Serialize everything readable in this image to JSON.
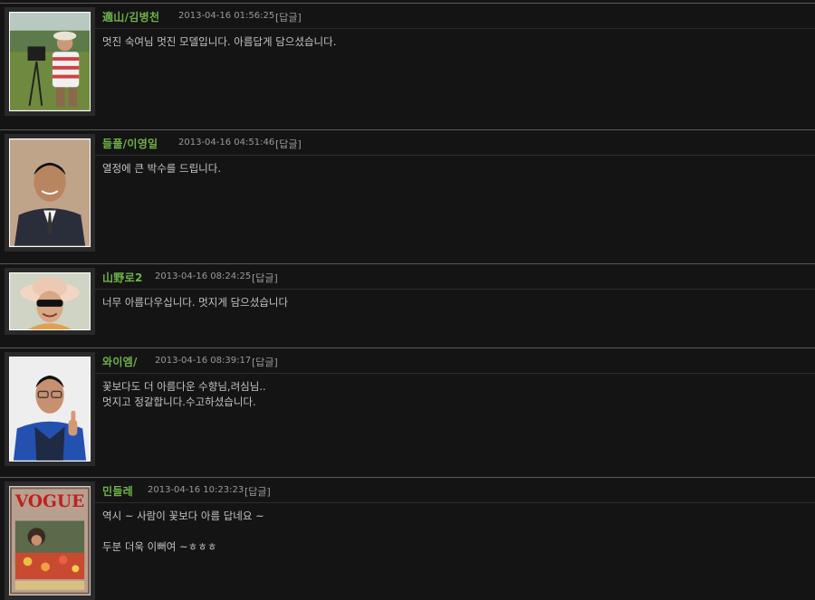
{
  "comments": [
    {
      "author": "適山/김병천",
      "date": "2013-04-16 01:56:25",
      "reply": "[답글]",
      "text": "멋진 숙여님 멋진 모델입니다. 아름답게 담으셨습니다."
    },
    {
      "author": "들풀/이영일",
      "date": "2013-04-16 04:51:46",
      "reply": "[답글]",
      "text": "열정에 큰 박수를 드립니다."
    },
    {
      "author": "山野로2",
      "date": "2013-04-16 08:24:25",
      "reply": "[답글]",
      "text": "너무 아름다우십니다. 멋지게 담으셨습니다"
    },
    {
      "author": "와이엠/",
      "date": "2013-04-16 08:39:17",
      "reply": "[답글]",
      "text": "꽃보다도 더 아름다운 수향님,려심님..\n멋지고 정갈합니다.수고하셨습니다."
    },
    {
      "author": "민들레",
      "date": "2013-04-16 10:23:23",
      "reply": "[답글]",
      "text": "역시 ~ 사람이 꽃보다 아름 답네요 ~\n\n두분 더욱 이뻐여 ~ㅎㅎㅎ",
      "photo_text": "VOGUE"
    }
  ]
}
